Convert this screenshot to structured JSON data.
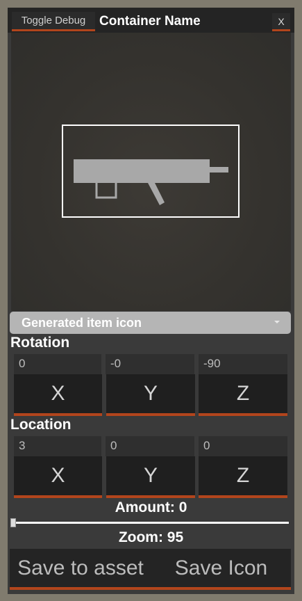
{
  "header": {
    "toggle_debug_label": "Toggle Debug",
    "title": "Container Name",
    "close_label": "X"
  },
  "preview": {
    "icon": "rifle-icon"
  },
  "dropdown": {
    "selected": "Generated item icon"
  },
  "rotation": {
    "label": "Rotation",
    "values": [
      "0",
      "-0",
      "-90"
    ],
    "axes": [
      "X",
      "Y",
      "Z"
    ]
  },
  "location": {
    "label": "Location",
    "values": [
      "3",
      "0",
      "0"
    ],
    "axes": [
      "X",
      "Y",
      "Z"
    ]
  },
  "amount": {
    "label": "Amount: 0",
    "value": 0
  },
  "zoom": {
    "label": "Zoom: 95"
  },
  "actions": {
    "save_to_asset": "Save to asset",
    "save_icon": "Save Icon"
  },
  "colors": {
    "accent": "#b2451c",
    "panel": "#3a3a3a",
    "background": "#807b6e"
  }
}
